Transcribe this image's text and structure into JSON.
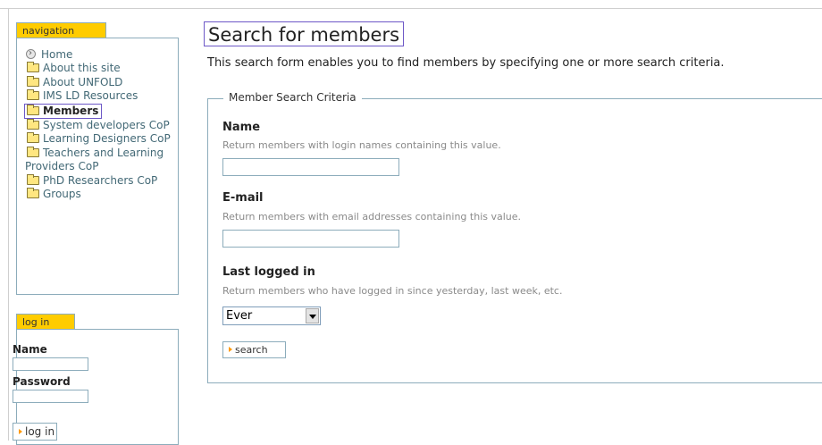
{
  "navigation": {
    "title": "navigation",
    "items": [
      {
        "label": "Home",
        "icon": "home-icon"
      },
      {
        "label": "About this site",
        "icon": "folder-icon"
      },
      {
        "label": "About UNFOLD",
        "icon": "folder-icon"
      },
      {
        "label": "IMS LD Resources",
        "icon": "folder-icon"
      },
      {
        "label": "Members",
        "icon": "folder-icon",
        "current": true
      },
      {
        "label": "System developers CoP",
        "icon": "folder-icon"
      },
      {
        "label": "Learning Designers CoP",
        "icon": "folder-icon"
      },
      {
        "label": "Teachers and Learning Providers CoP",
        "icon": "folder-icon"
      },
      {
        "label": "PhD Researchers CoP",
        "icon": "folder-icon"
      },
      {
        "label": "Groups",
        "icon": "folder-icon"
      }
    ]
  },
  "login": {
    "title": "log in",
    "name_label": "Name",
    "password_label": "Password",
    "button_label": "log in"
  },
  "main": {
    "title": "Search for members",
    "intro": "This search form enables you to find members by specifying one or more search criteria.",
    "fieldset_legend": "Member Search Criteria",
    "fields": {
      "name": {
        "label": "Name",
        "help": "Return members with login names containing this value.",
        "value": ""
      },
      "email": {
        "label": "E-mail",
        "help": "Return members with email addresses containing this value.",
        "value": ""
      },
      "last_logged_in": {
        "label": "Last logged in",
        "help": "Return members who have logged in since yesterday, last week, etc.",
        "selected": "Ever"
      }
    },
    "search_button": "search"
  },
  "colors": {
    "tab_yellow": "#ffcc00",
    "border_blue": "#8cacbb",
    "highlight_purple": "#6d58c7",
    "link": "#436976"
  }
}
